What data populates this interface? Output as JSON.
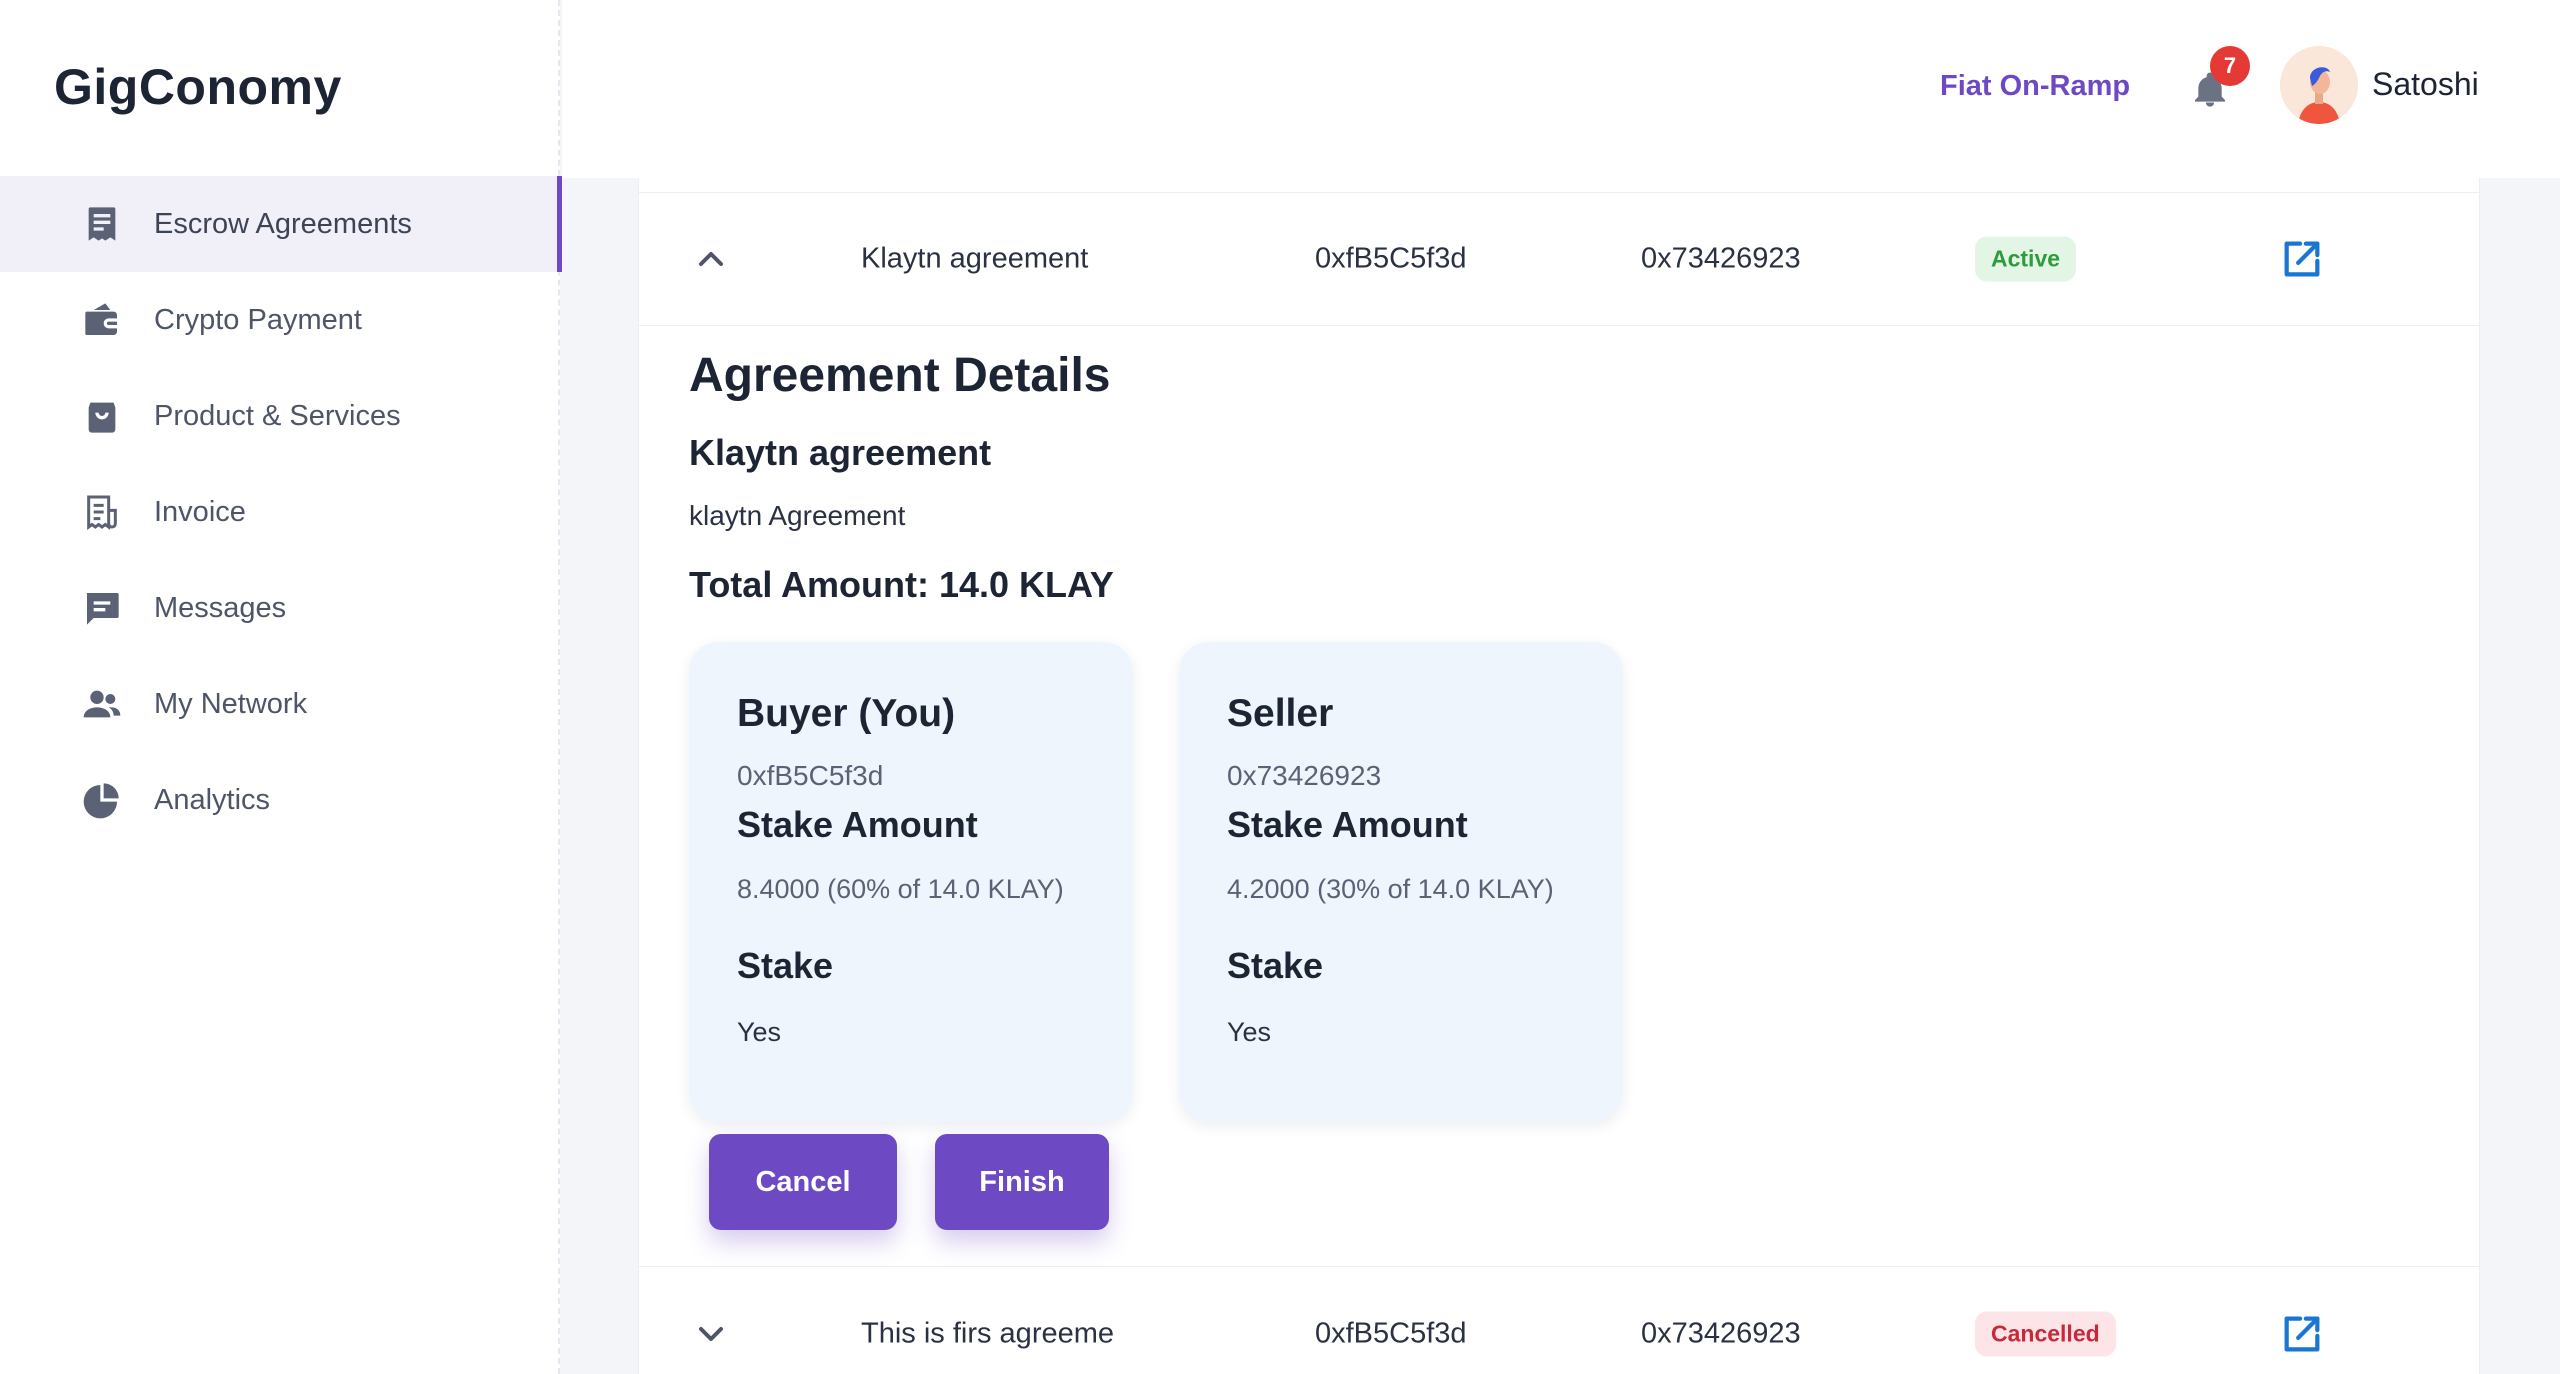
{
  "app": {
    "logo": "GigConomy"
  },
  "sidebar": {
    "items": [
      {
        "label": "Escrow Agreements",
        "icon": "receipt-icon",
        "active": true
      },
      {
        "label": "Crypto Payment",
        "icon": "wallet-icon",
        "active": false
      },
      {
        "label": "Product & Services",
        "icon": "shopping-bag-icon",
        "active": false
      },
      {
        "label": "Invoice",
        "icon": "invoice-icon",
        "active": false
      },
      {
        "label": "Messages",
        "icon": "message-icon",
        "active": false
      },
      {
        "label": "My Network",
        "icon": "people-icon",
        "active": false
      },
      {
        "label": "Analytics",
        "icon": "pie-chart-icon",
        "active": false
      }
    ]
  },
  "header": {
    "fiat_label": "Fiat On-Ramp",
    "notification_count": "7",
    "username": "Satoshi"
  },
  "agreements": [
    {
      "name": "Klaytn agreement",
      "buyer": "0xfB5C5f3d",
      "seller": "0x73426923",
      "status": "Active",
      "expanded": true
    },
    {
      "name": "This is firs agreeme",
      "buyer": "0xfB5C5f3d",
      "seller": "0x73426923",
      "status": "Cancelled",
      "expanded": false
    }
  ],
  "details": {
    "heading": "Agreement Details",
    "name": "Klaytn agreement",
    "description": "klaytn Agreement",
    "total": "Total Amount: 14.0 KLAY",
    "buyer_card": {
      "title": "Buyer (You)",
      "address": "0xfB5C5f3d",
      "stake_amount_label": "Stake Amount",
      "stake_amount": "8.4000 (60% of 14.0 KLAY)",
      "stake_label": "Stake",
      "stake_value": "Yes"
    },
    "seller_card": {
      "title": "Seller",
      "address": "0x73426923",
      "stake_amount_label": "Stake Amount",
      "stake_amount": "4.2000 (30% of 14.0 KLAY)",
      "stake_label": "Stake",
      "stake_value": "Yes"
    },
    "cancel_label": "Cancel",
    "finish_label": "Finish"
  },
  "colors": {
    "accent": "#6e49c4",
    "active_badge_bg": "#e3f6e5",
    "active_badge_text": "#2e9b3d",
    "cancel_badge_bg": "#fde4e6",
    "cancel_badge_text": "#c8283a",
    "link_blue": "#1976d2"
  }
}
